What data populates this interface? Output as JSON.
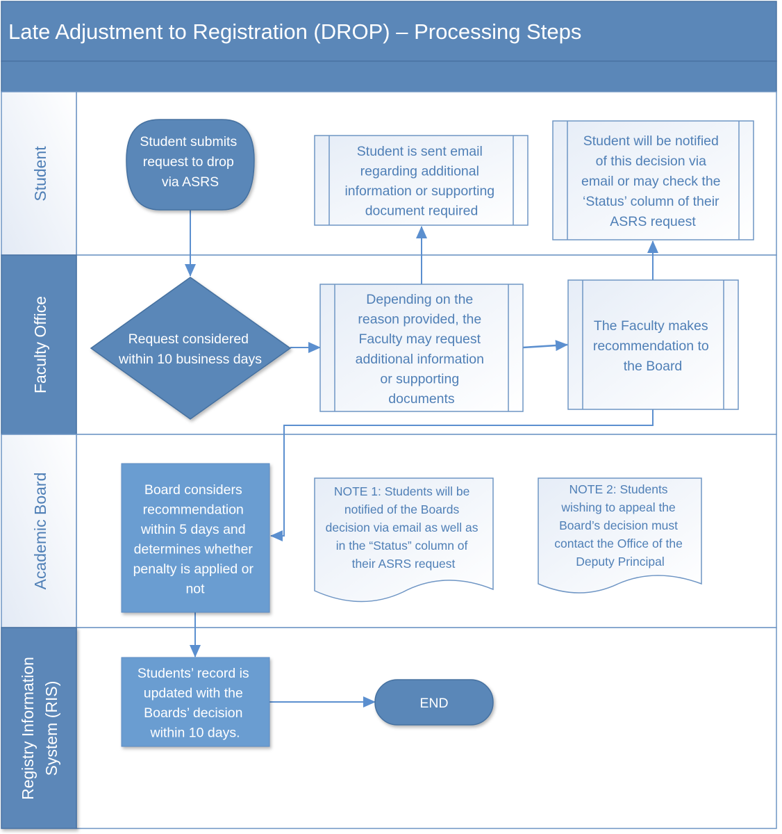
{
  "title": "Late Adjustment to Registration (DROP) – Processing Steps",
  "colors": {
    "header": "#5b87b8",
    "dark_node": "#5a87b8",
    "light_node": "#6a9dd1",
    "line": "#5b8fcf",
    "text_blue": "#4f7fb6"
  },
  "lanes": [
    {
      "id": "student",
      "label": [
        "Student"
      ],
      "style": "light"
    },
    {
      "id": "faculty",
      "label": [
        "Faculty Office"
      ],
      "style": "dark"
    },
    {
      "id": "board",
      "label": [
        "Academic Board"
      ],
      "style": "light"
    },
    {
      "id": "ris",
      "label": [
        "Registry Information",
        "System (RIS)"
      ],
      "style": "dark"
    }
  ],
  "nodes": {
    "start": {
      "shape": "terminator",
      "lines": [
        "Student submits",
        "request to drop",
        "via ASRS"
      ]
    },
    "email_required": {
      "shape": "subprocess",
      "lines": [
        "Student is sent email",
        "regarding additional",
        "information or supporting",
        "document required"
      ]
    },
    "notified": {
      "shape": "subprocess",
      "lines": [
        "Student will be notified",
        "of this decision via",
        "email or may check the",
        "‘Status’ column of their",
        "ASRS request"
      ]
    },
    "decision": {
      "shape": "decision",
      "lines": [
        "Request considered",
        "within 10 business days"
      ]
    },
    "request_info": {
      "shape": "subprocess",
      "lines": [
        "Depending on the",
        "reason provided, the",
        "Faculty may request",
        "additional information",
        "or supporting",
        "documents"
      ]
    },
    "recommendation": {
      "shape": "subprocess",
      "lines": [
        "The Faculty makes",
        "recommendation to",
        "the Board"
      ]
    },
    "board_considers": {
      "shape": "process",
      "lines": [
        "Board considers",
        "recommendation",
        "within 5 days and",
        "determines whether",
        "penalty is applied or",
        "not"
      ]
    },
    "note1": {
      "shape": "document",
      "lines": [
        "NOTE 1:  Students will be",
        "notified of the Boards",
        "decision via email as well as",
        "in the “Status” column of",
        "their ASRS request"
      ]
    },
    "note2": {
      "shape": "document",
      "lines": [
        "NOTE 2:  Students",
        "wishing to appeal the",
        "Board’s decision must",
        "contact the Office of the",
        "Deputy Principal"
      ]
    },
    "record_updated": {
      "shape": "process",
      "lines": [
        "Students’ record is",
        "updated with the",
        "Boards’ decision",
        "within 10 days."
      ]
    },
    "end": {
      "shape": "terminator",
      "lines": [
        "END"
      ]
    }
  },
  "edges": [
    {
      "from": "start",
      "to": "decision"
    },
    {
      "from": "decision",
      "to": "request_info"
    },
    {
      "from": "request_info",
      "to": "email_required"
    },
    {
      "from": "request_info",
      "to": "recommendation"
    },
    {
      "from": "recommendation",
      "to": "notified"
    },
    {
      "from": "recommendation",
      "to": "board_considers"
    },
    {
      "from": "board_considers",
      "to": "record_updated"
    },
    {
      "from": "record_updated",
      "to": "end"
    }
  ]
}
